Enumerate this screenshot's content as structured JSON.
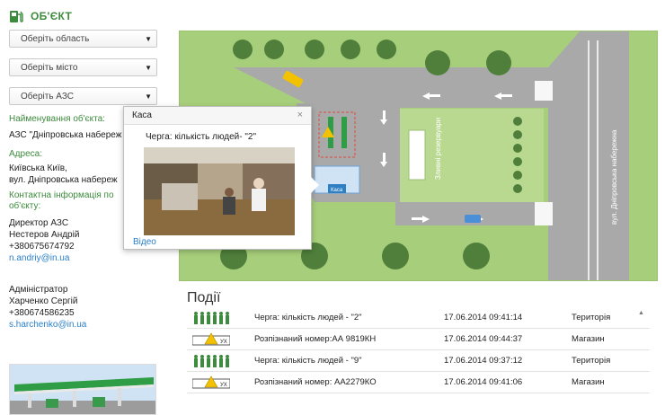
{
  "header": {
    "title": "ОБ'ЄКТ",
    "icon": "fuel-pump-icon"
  },
  "filters": [
    {
      "placeholder": "Оберіть область"
    },
    {
      "placeholder": "Оберіть місто"
    },
    {
      "placeholder": "Оберіть АЗС"
    }
  ],
  "object": {
    "name_label": "Найменування об'єкта:",
    "name_value": "АЗС \"Дніпровська набереж",
    "address_label": "Адреса:",
    "address_line1": "Київська Київ,",
    "address_line2": "вул. Дніпровська набереж",
    "contact_label_line1": "Контактна інформація по",
    "contact_label_line2": "об'єкту:",
    "contact1": {
      "role": "Директор АЗС",
      "name": "Нестеров Андрій",
      "phone": "+380675674792",
      "email": "n.andriy@in.ua"
    },
    "contact2": {
      "role": "Адміністратор",
      "name": "Харченко Сергій",
      "phone": "+380674586235",
      "email": "s.harchenko@in.ua"
    }
  },
  "map": {
    "label_reservoirs": "Зливні резервуари",
    "label_street": "вул. Дніпровська набережна",
    "label_kasa": "Каса",
    "colors": {
      "grass": "#a7cf7b",
      "road": "#a9a9a9",
      "accent": "#3d8b3d"
    }
  },
  "popup": {
    "title": "Каса",
    "close": "×",
    "message": "Черга: кількість людей- \"2\"",
    "video_link": "Відео"
  },
  "events": {
    "title": "Події",
    "rows": [
      {
        "icon": "people-queue-icon",
        "description": "Черга: кількість людей - \"2\"",
        "datetime": "17.06.2014 09:41:14",
        "zone": "Територія"
      },
      {
        "icon": "license-plate-warning-icon",
        "description": "Розпізнаний номер:АА 9819КН",
        "datetime": "17.06.2014 09:44:37",
        "zone": "Магазин"
      },
      {
        "icon": "people-queue-icon",
        "description": "Черга: кількість людей - \"9\"",
        "datetime": "17.06.2014 09:37:12",
        "zone": "Територія"
      },
      {
        "icon": "license-plate-warning-icon",
        "description": "Розпізнаний номер: АА2279КО",
        "datetime": "17.06.2014 09:41:06",
        "zone": "Магазин"
      }
    ]
  },
  "plate_text": "УХ"
}
